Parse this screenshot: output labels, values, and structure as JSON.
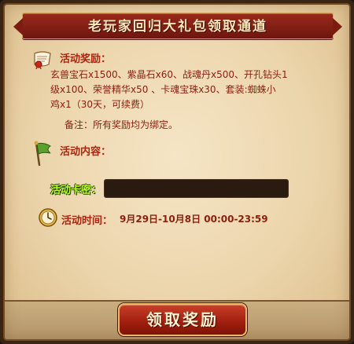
{
  "title": "老玩家回归大礼包领取通道",
  "reward": {
    "label": "活动奖励：",
    "line1": "玄兽宝石x1500、紫晶石x60、战魂丹x500、开孔钻头1",
    "line2": "级x100、荣誉精华x50 、卡魂宝珠x30、套装:蜘蛛小",
    "line3": "鸡x1（30天，可续费）",
    "note": "备注：所有奖励均为绑定。"
  },
  "content": {
    "label": "活动内容："
  },
  "code": {
    "label": "活动卡密：",
    "value": "",
    "placeholder": ""
  },
  "time": {
    "label": "活动时间：",
    "value": "9月29日-10月8日  00:00-23:59"
  },
  "claim_button_label": "领取奖励",
  "icons": {
    "reward": "scroll-icon",
    "content": "flag-icon",
    "time": "compass-clock-icon"
  },
  "colors": {
    "title_red": "#8a2214",
    "text_red": "#8a1f10",
    "label_red": "#b0230f",
    "code_label_green": "#b9ff2a",
    "code_field_bg": "#2a1a10"
  }
}
